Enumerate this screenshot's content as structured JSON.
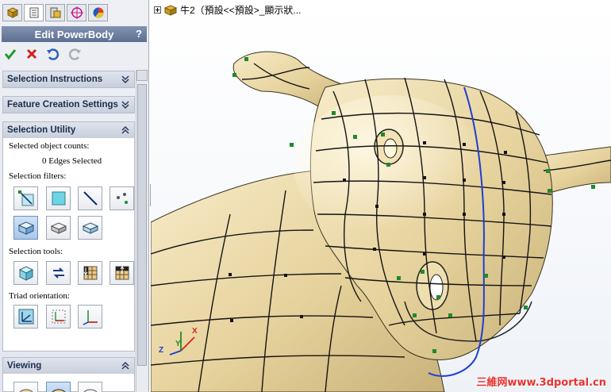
{
  "property_manager": {
    "tabs": [
      "feature-manager-icon",
      "property-manager-icon",
      "configuration-manager-icon",
      "dim-xpert-icon",
      "display-manager-icon"
    ],
    "title": "Edit PowerBody",
    "help": "?"
  },
  "groups": {
    "selection_instructions": "Selection Instructions",
    "feature_creation": "Feature Creation Settings",
    "selection_utility": "Selection Utility",
    "viewing": "Viewing"
  },
  "selection_utility": {
    "counts_label": "Selected object counts:",
    "edges_selected": "0 Edges Selected",
    "filters_label": "Selection filters:",
    "tools_label": "Selection tools:",
    "triad_label": "Triad orientation:"
  },
  "model": {
    "tree_text": "牛2（預設<<預設>_顯示狀..."
  },
  "triad": {
    "x": "X",
    "y": "Y",
    "z": "Z"
  },
  "watermark": "三維网www.3dportal.cn",
  "colors": {
    "surface": "#e9d7a4",
    "header": "#5d6f92",
    "control_point": "#1f8a2a",
    "edge_highlight": "#1f3fd1"
  }
}
